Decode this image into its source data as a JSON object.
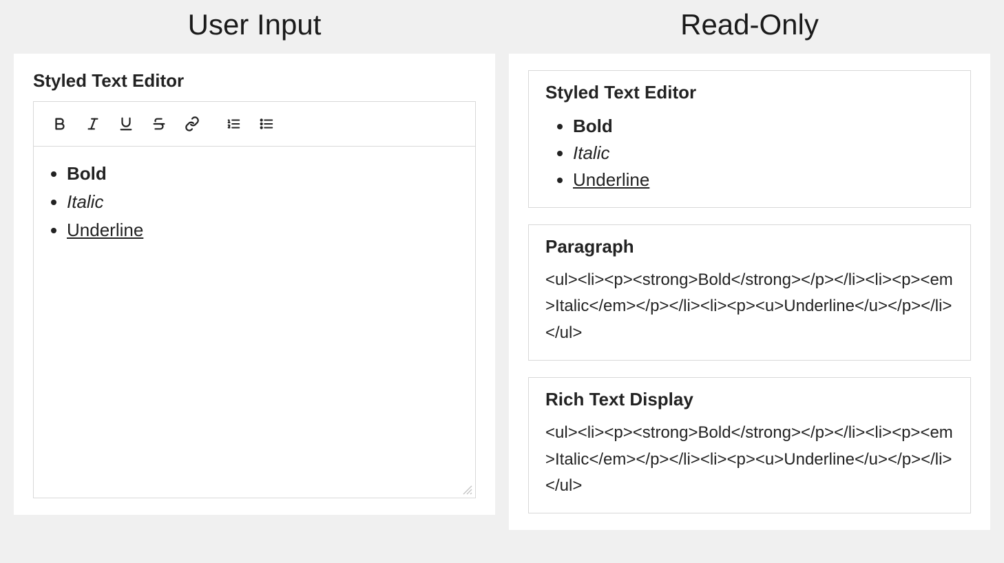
{
  "left": {
    "heading": "User Input",
    "editor": {
      "title": "Styled Text Editor",
      "toolbar": {
        "bold": "bold",
        "italic": "italic",
        "underline": "underline",
        "strike": "strikethrough",
        "link": "link",
        "olist": "ordered-list",
        "ulist": "unordered-list"
      },
      "content": {
        "items": [
          {
            "text": "Bold",
            "style": "bold"
          },
          {
            "text": "Italic",
            "style": "italic"
          },
          {
            "text": "Underline",
            "style": "underline"
          }
        ]
      }
    }
  },
  "right": {
    "heading": "Read-Only",
    "cards": {
      "styled": {
        "title": "Styled Text Editor",
        "items": [
          {
            "text": "Bold",
            "style": "bold"
          },
          {
            "text": "Italic",
            "style": "italic"
          },
          {
            "text": "Underline",
            "style": "underline"
          }
        ]
      },
      "paragraph": {
        "title": "Paragraph",
        "raw": "<ul><li><p><strong>Bold</strong></p></li><li><p><em>Italic</em></p></li><li><p><u>Underline</u></p></li></ul>"
      },
      "richtext": {
        "title": "Rich Text Display",
        "raw": "<ul><li><p><strong>Bold</strong></p></li><li><p><em>Italic</em></p></li><li><p><u>Underline</u></p></li></ul>"
      }
    }
  }
}
